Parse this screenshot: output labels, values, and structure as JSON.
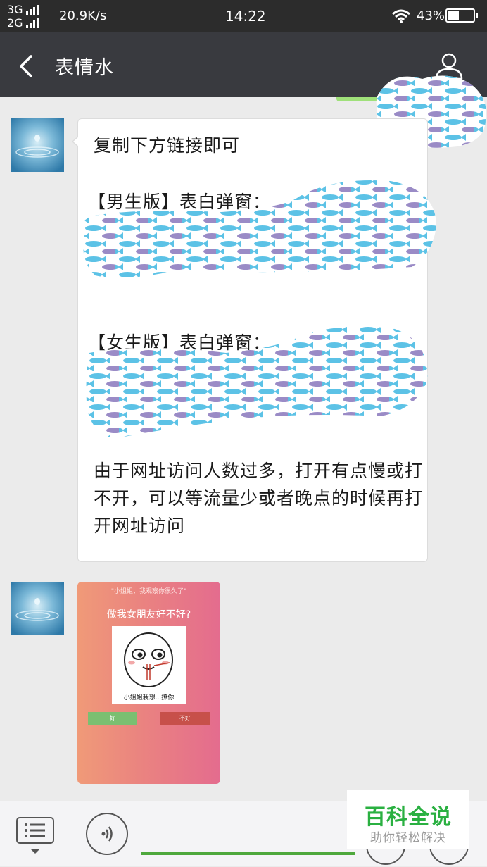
{
  "status_bar": {
    "network_top": "3G",
    "network_bottom": "2G",
    "speed": "20.9K/s",
    "time": "14:22",
    "battery_text": "43%",
    "battery_level": 0.43
  },
  "header": {
    "title": "表情水"
  },
  "messages": [
    {
      "line1": "复制下方链接即可",
      "male_label": "【男生版】表白弹窗：",
      "female_label": "【女生版】表白弹窗：",
      "note": "由于网址访问人数过多，打开有点慢或打不开，可以等流量少或者晚点的时候再打开网址访问"
    }
  ],
  "image_card": {
    "quote": "\"小姐姐，我观察你很久了\"",
    "headline": "做我女朋友好不好?",
    "caption": "小姐姐我想...撩你",
    "yes_label": "好",
    "no_label": "不好"
  },
  "watermark": {
    "title": "百科全说",
    "subtitle": "助你轻松解决"
  },
  "colors": {
    "titlebar": "#393a3f",
    "fish_blue": "#5cc2e6",
    "fish_purple": "#9a8bc6",
    "brand_green": "#2ab041"
  },
  "icons": [
    "back-arrow-icon",
    "person-icon",
    "menu-list-icon",
    "voice-icon",
    "wifi-icon",
    "battery-icon"
  ]
}
